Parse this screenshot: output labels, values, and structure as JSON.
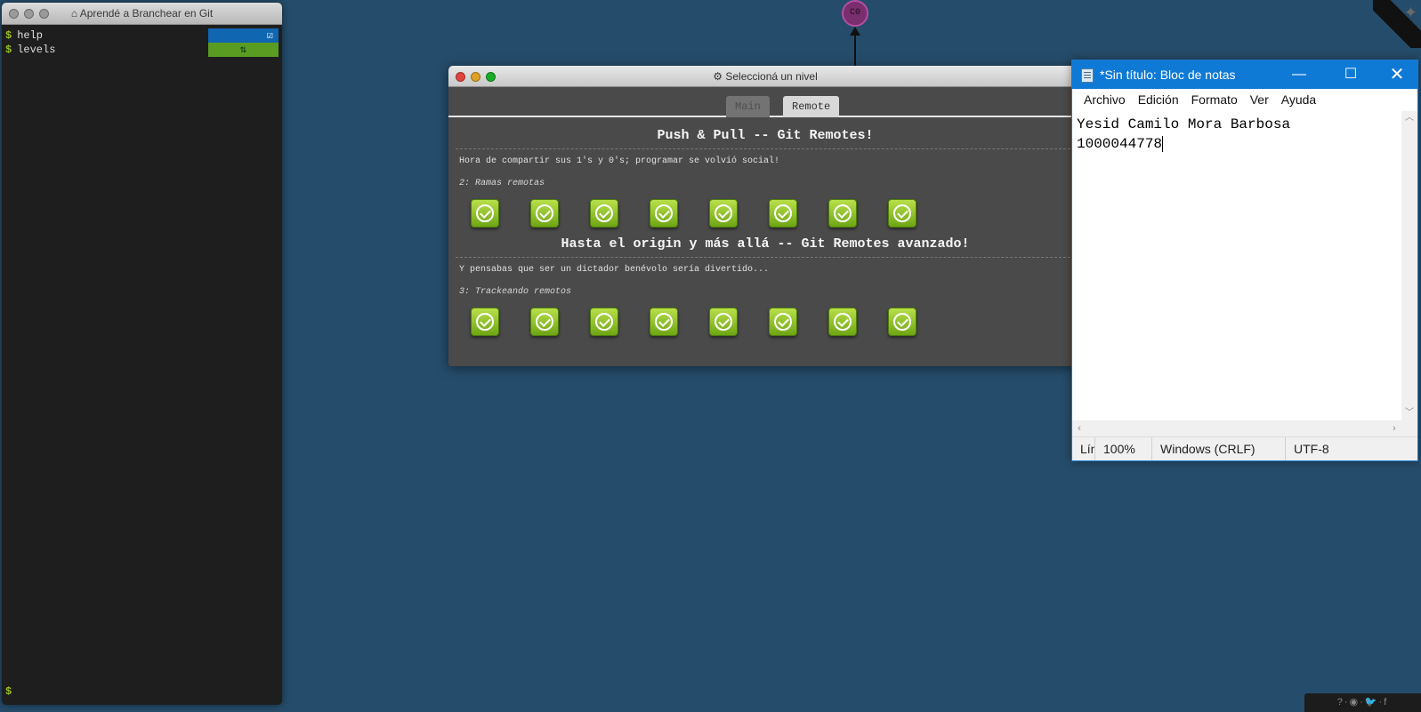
{
  "terminal": {
    "title": "Aprendé a Branchear en Git",
    "prompt_symbol": "$",
    "lines": [
      {
        "command": "help",
        "badge": "☑"
      },
      {
        "command": "levels",
        "badge": "⇅"
      }
    ]
  },
  "commit_node": {
    "label": "C0"
  },
  "level_dialog": {
    "title": "Seleccioná un nivel",
    "tabs": [
      {
        "label": "Main"
      },
      {
        "label": "Remote"
      }
    ],
    "sections": [
      {
        "title": "Push & Pull -- Git Remotes!",
        "description": "Hora de compartir sus 1's y 0's; programar se volvió social!",
        "subtitle": "2: Ramas remotas",
        "levels_completed": 8
      },
      {
        "title": "Hasta el origin y más allá -- Git Remotes avanzado!",
        "description": "Y pensabas que ser un dictador benévolo sería divertido...",
        "subtitle": "3: Trackeando remotos",
        "levels_completed": 8
      }
    ]
  },
  "notepad": {
    "title": "*Sin título: Bloc de notas",
    "menu": [
      "Archivo",
      "Edición",
      "Formato",
      "Ver",
      "Ayuda"
    ],
    "content_lines": [
      "Yesid Camilo Mora Barbosa",
      "1000044778"
    ],
    "status": {
      "position": "Lín",
      "zoom": "100%",
      "line_ending": "Windows (CRLF)",
      "encoding": "UTF-8"
    }
  },
  "colors": {
    "background": "#254c6a",
    "level_complete": "#8cc63f",
    "notepad_titlebar": "#0f7ad6"
  }
}
